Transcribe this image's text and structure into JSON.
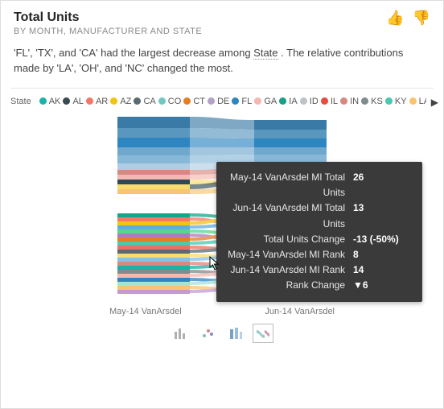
{
  "header": {
    "title": "Total Units",
    "subtitle": "BY MONTH, MANUFACTURER AND STATE"
  },
  "insight": {
    "text_before": "'FL', 'TX', and 'CA' had the largest decrease among ",
    "link_text": "State",
    "text_after": " . The relative contributions made by 'LA', 'OH', and 'NC' changed the most."
  },
  "legend": {
    "label": "State",
    "items": [
      {
        "name": "AK",
        "color": "#1ab2a8"
      },
      {
        "name": "AL",
        "color": "#3a4a52"
      },
      {
        "name": "AR",
        "color": "#f6776a"
      },
      {
        "name": "AZ",
        "color": "#f1c40f"
      },
      {
        "name": "CA",
        "color": "#5a6a72"
      },
      {
        "name": "CO",
        "color": "#6fc9c2"
      },
      {
        "name": "CT",
        "color": "#e67e22"
      },
      {
        "name": "DE",
        "color": "#b6a1c9"
      },
      {
        "name": "FL",
        "color": "#2e86c1"
      },
      {
        "name": "GA",
        "color": "#f5b7b1"
      },
      {
        "name": "IA",
        "color": "#16a085"
      },
      {
        "name": "ID",
        "color": "#bdc3c7"
      },
      {
        "name": "IL",
        "color": "#e74c3c"
      },
      {
        "name": "IN",
        "color": "#d98880"
      },
      {
        "name": "KS",
        "color": "#7f8c8d"
      },
      {
        "name": "KY",
        "color": "#48c9b0"
      },
      {
        "name": "LA",
        "color": "#f8c471"
      }
    ]
  },
  "axis": {
    "left": "May-14 VanArsdel",
    "right": "Jun-14 VanArsdel"
  },
  "tooltip": {
    "rows": [
      {
        "k": "May-14 VanArsdel MI Total Units",
        "v": "26"
      },
      {
        "k": "Jun-14 VanArsdel MI Total Units",
        "v": "13"
      },
      {
        "k": "Total Units Change",
        "v": "-13 (-50%)"
      },
      {
        "k": "May-14 VanArsdel MI Rank",
        "v": "8"
      },
      {
        "k": "Jun-14 VanArsdel MI Rank",
        "v": "14"
      },
      {
        "k": "Rank Change",
        "v": "▼6"
      }
    ]
  },
  "chart_data": {
    "type": "area",
    "note": "Ribbon/sankey-style chart; each ribbon is a State flowing between two stacked columns representing periods.",
    "categories": [
      "May-14 VanArsdel",
      "Jun-14 VanArsdel"
    ],
    "xlabel": "",
    "ylabel": "Total Units",
    "highlighted_state": "MI",
    "highlighted": {
      "state": "MI",
      "total_units": {
        "May-14": 26,
        "Jun-14": 13
      },
      "rank": {
        "May-14": 8,
        "Jun-14": 14
      },
      "units_change": -13,
      "units_change_pct": -50,
      "rank_change": -6
    },
    "series": [
      {
        "name": "AK",
        "color": "#1ab2a8"
      },
      {
        "name": "AL",
        "color": "#3a4a52"
      },
      {
        "name": "AR",
        "color": "#f6776a"
      },
      {
        "name": "AZ",
        "color": "#f1c40f"
      },
      {
        "name": "CA",
        "color": "#5a6a72"
      },
      {
        "name": "CO",
        "color": "#6fc9c2"
      },
      {
        "name": "CT",
        "color": "#e67e22"
      },
      {
        "name": "DE",
        "color": "#b6a1c9"
      },
      {
        "name": "FL",
        "color": "#2e86c1"
      },
      {
        "name": "GA",
        "color": "#f5b7b1"
      },
      {
        "name": "IA",
        "color": "#16a085"
      },
      {
        "name": "ID",
        "color": "#bdc3c7"
      },
      {
        "name": "IL",
        "color": "#e74c3c"
      },
      {
        "name": "IN",
        "color": "#d98880"
      },
      {
        "name": "KS",
        "color": "#7f8c8d"
      },
      {
        "name": "KY",
        "color": "#48c9b0"
      },
      {
        "name": "LA",
        "color": "#f8c471"
      }
    ]
  }
}
